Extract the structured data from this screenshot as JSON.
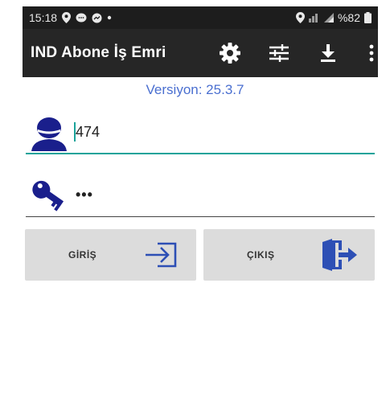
{
  "status": {
    "time": "15:18",
    "battery": "%82"
  },
  "app": {
    "title": "IND Abone İş Emri",
    "version": "Versiyon: 25.3.7"
  },
  "login": {
    "username_value": "474",
    "password_value": "•••"
  },
  "buttons": {
    "login_label": "GİRİŞ",
    "exit_label": "ÇIKIŞ"
  },
  "colors": {
    "accent_teal": "#1aa39a",
    "icon_navy": "#1a1f8c",
    "version_blue": "#4a6fd0",
    "button_bg": "#dcdcdc"
  },
  "icons": {
    "appbar": [
      "gear-icon",
      "sliders-icon",
      "download-icon",
      "more-vert-icon"
    ],
    "fields": [
      "user-icon",
      "key-icon"
    ],
    "buttons": [
      "login-icon",
      "exit-door-icon"
    ]
  }
}
